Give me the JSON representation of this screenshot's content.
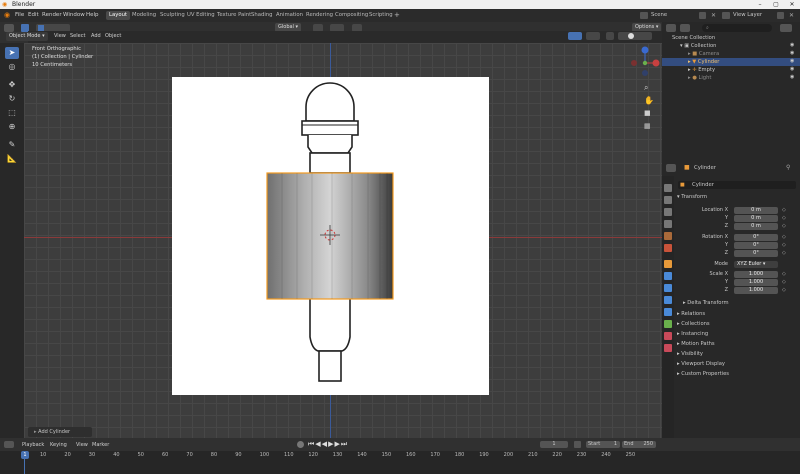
{
  "window": {
    "title": "Blender"
  },
  "menu": [
    "File",
    "Edit",
    "Render",
    "Window",
    "Help"
  ],
  "workspaces": [
    {
      "label": "Layout",
      "active": true
    },
    {
      "label": "Modeling"
    },
    {
      "label": "Sculpting"
    },
    {
      "label": "UV Editing"
    },
    {
      "label": "Texture Paint"
    },
    {
      "label": "Shading"
    },
    {
      "label": "Animation"
    },
    {
      "label": "Rendering"
    },
    {
      "label": "Compositing"
    },
    {
      "label": "Scripting"
    }
  ],
  "scene": {
    "name": "Scene",
    "view_layer": "View Layer"
  },
  "viewport_header": {
    "mode": "Object Mode",
    "menus": [
      "View",
      "Select",
      "Add",
      "Object"
    ],
    "transform": "Global",
    "options": "Options"
  },
  "overlay": {
    "view": "Front Orthographic",
    "collection": "(1) Collection | Cylinder",
    "scale": "10 Centimeters"
  },
  "last_operator": "Add Cylinder",
  "outliner": {
    "root": "Scene Collection",
    "items": [
      {
        "label": "Collection",
        "indent": 1
      },
      {
        "label": "Camera",
        "indent": 2,
        "dim": true
      },
      {
        "label": "Cylinder",
        "indent": 2,
        "selected": true
      },
      {
        "label": "Empty",
        "indent": 2
      },
      {
        "label": "Light",
        "indent": 2,
        "dim": true
      }
    ]
  },
  "properties": {
    "object_name": "Cylinder",
    "name_field": "Cylinder",
    "transform_title": "Transform",
    "location_label": "Location X",
    "location": [
      "0 m",
      "0 m",
      "0 m"
    ],
    "rotation_label": "Rotation X",
    "rotation": [
      "0°",
      "0°",
      "0°"
    ],
    "mode_label": "Mode",
    "mode": "XYZ Euler",
    "scale_label": "Scale X",
    "scale": [
      "1.000",
      "1.000",
      "1.000"
    ],
    "axis_labels": [
      "Y",
      "Z"
    ],
    "sections": [
      "Delta Transform",
      "Relations",
      "Collections",
      "Instancing",
      "Motion Paths",
      "Visibility",
      "Viewport Display",
      "Custom Properties"
    ]
  },
  "timeline": {
    "menus": [
      "Playback",
      "Keying",
      "View",
      "Marker"
    ],
    "current_frame": "1",
    "start_label": "Start",
    "start": "1",
    "end_label": "End",
    "end": "250",
    "ticks": [
      "10",
      "20",
      "30",
      "40",
      "50",
      "60",
      "70",
      "80",
      "90",
      "100",
      "110",
      "120",
      "130",
      "140",
      "150",
      "160",
      "170",
      "180",
      "190",
      "200",
      "210",
      "220",
      "230",
      "240",
      "250"
    ]
  },
  "colors": {
    "accent": "#4772b3",
    "selection": "#f29a1f",
    "x_axis": "#8a3a3a",
    "y_axis": "#3a5a9a"
  }
}
